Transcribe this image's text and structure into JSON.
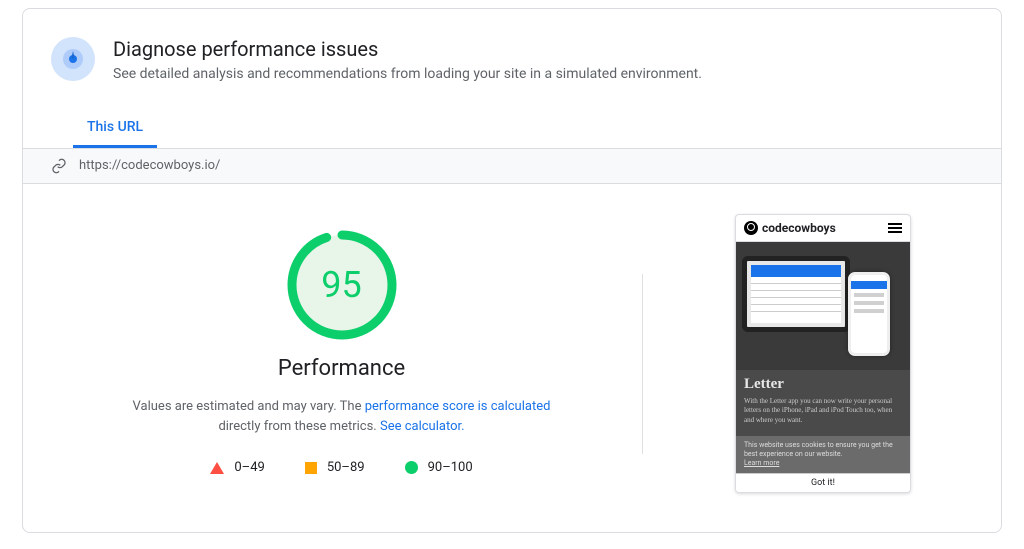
{
  "header": {
    "title": "Diagnose performance issues",
    "subtitle": "See detailed analysis and recommendations from loading your site in a simulated environment."
  },
  "tabs": {
    "this_url": "This URL"
  },
  "url_bar": {
    "url": "https://codecowboys.io/"
  },
  "performance": {
    "score": "95",
    "label": "Performance",
    "desc_prefix": "Values are estimated and may vary. The ",
    "desc_link1": "performance score is calculated",
    "desc_mid": " directly from these metrics. ",
    "desc_link2": "See calculator."
  },
  "legend": {
    "fail": "0–49",
    "average": "50–89",
    "pass": "90–100"
  },
  "preview": {
    "brand": "codecowboys",
    "hero_title": "Letter",
    "hero_text": "With the Letter app you can now write your personal letters on the iPhone, iPad and iPod Touch too, when and where you want.",
    "cookie_text": "This website uses cookies to ensure you get the best experience on our website.",
    "cookie_learn": "Learn more",
    "gotit": "Got it!"
  },
  "chart_data": {
    "type": "gauge",
    "value": 95,
    "min": 0,
    "max": 100,
    "ranges": [
      {
        "label": "0–49",
        "color": "#ff4e42"
      },
      {
        "label": "50–89",
        "color": "#ffa400"
      },
      {
        "label": "90–100",
        "color": "#0cce6b"
      }
    ],
    "title": "Performance"
  }
}
